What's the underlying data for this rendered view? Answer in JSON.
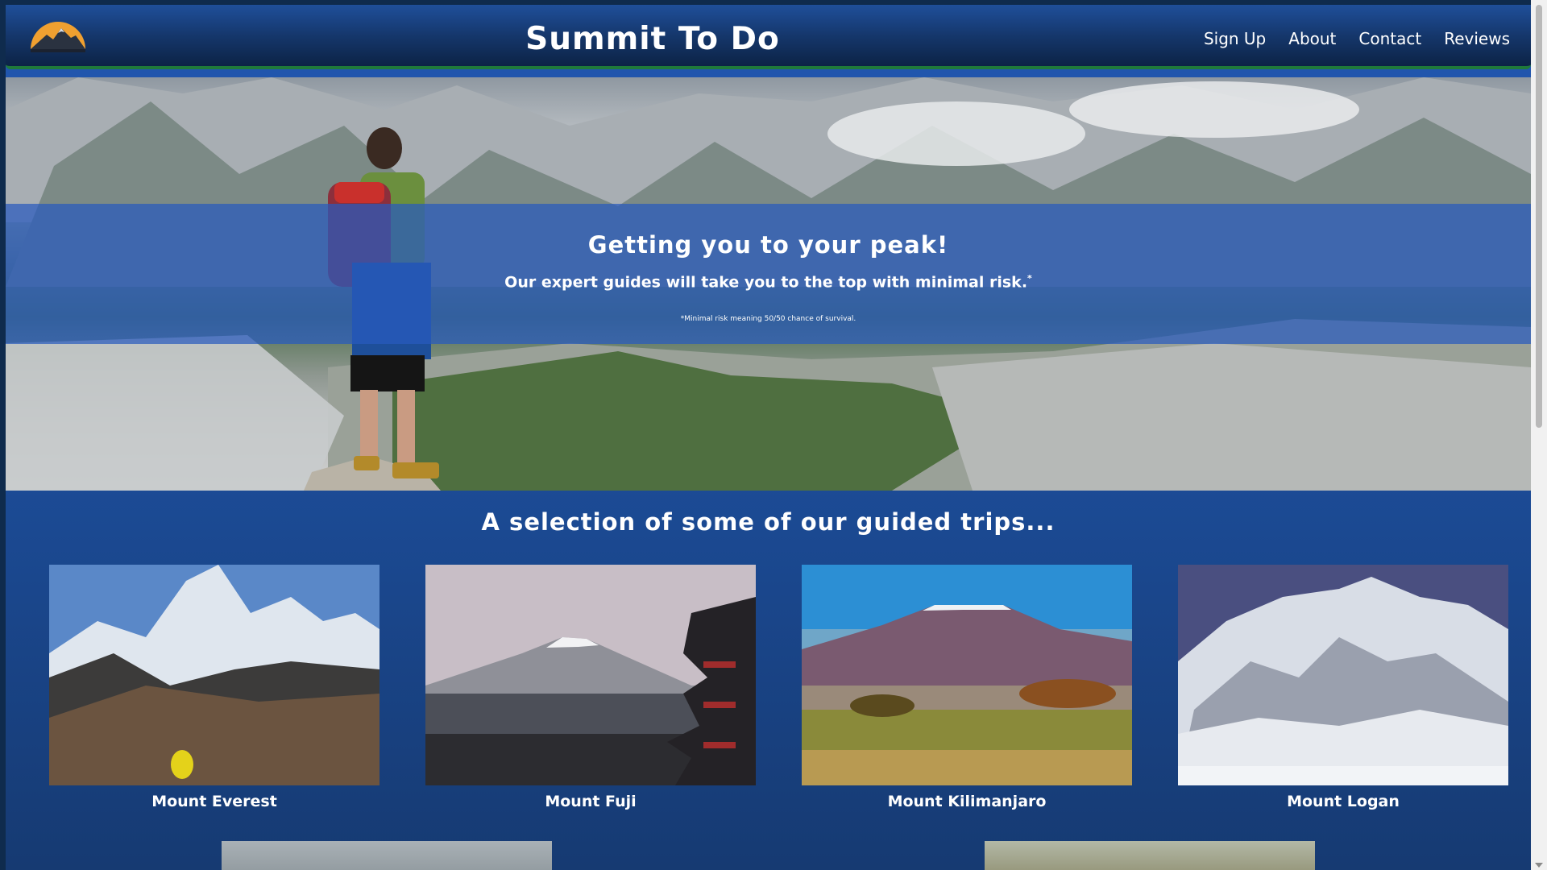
{
  "header": {
    "logo_icon": "mountain-sunrise-icon",
    "title": "Summit To Do",
    "nav": [
      {
        "label": "Sign Up"
      },
      {
        "label": "About"
      },
      {
        "label": "Contact"
      },
      {
        "label": "Reviews"
      }
    ]
  },
  "hero": {
    "heading": "Getting you to your peak!",
    "subheading": "Our expert guides will take you to the top with minimal risk.",
    "footnote_mark": "*",
    "footnote": "*Minimal risk meaning 50/50 chance of survival."
  },
  "trips": {
    "heading": "A selection of some of our guided trips...",
    "items": [
      {
        "name": "Mount Everest"
      },
      {
        "name": "Mount Fuji"
      },
      {
        "name": "Mount Kilimanjaro"
      },
      {
        "name": "Mount Logan"
      }
    ]
  },
  "colors": {
    "header_bg": "#15376c",
    "header_border": "#1f7a3a",
    "page_bg": "#1d4f9e",
    "banner_overlay": "#285abe",
    "text": "#ffffff"
  }
}
